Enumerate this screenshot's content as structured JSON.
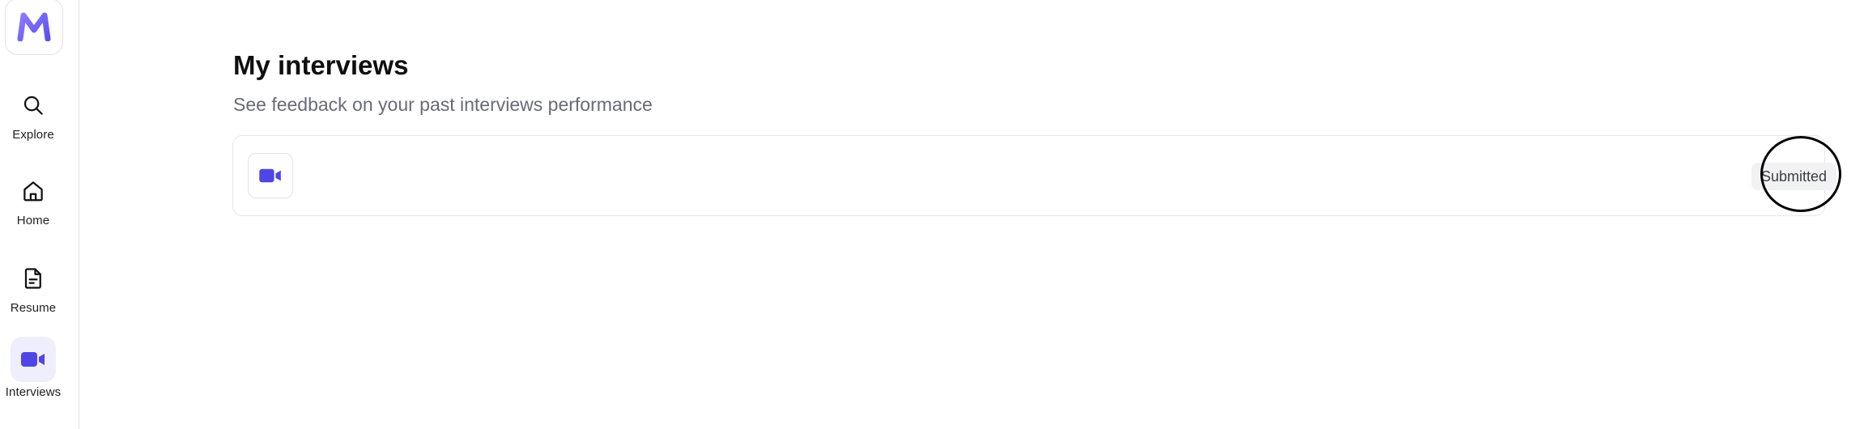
{
  "sidebar": {
    "logo_icon": "brand-m-logo",
    "brand_color": "#6c63ff",
    "items": [
      {
        "label": "Explore",
        "icon": "search-icon",
        "active": false
      },
      {
        "label": "Home",
        "icon": "home-icon",
        "active": false
      },
      {
        "label": "Resume",
        "icon": "document-icon",
        "active": false
      },
      {
        "label": "Interviews",
        "icon": "video-camera-icon",
        "active": true
      }
    ]
  },
  "main": {
    "title": "My interviews",
    "subtitle": "See feedback on your past interviews performance",
    "interviews": [
      {
        "icon": "video-camera-icon",
        "status": "Submitted",
        "more_icon": "more-horizontal-icon"
      }
    ]
  },
  "colors": {
    "accent": "#5046e5",
    "active_bg": "#efeefc",
    "badge_bg": "#f2f2f5",
    "subtitle": "#6a6a78"
  }
}
